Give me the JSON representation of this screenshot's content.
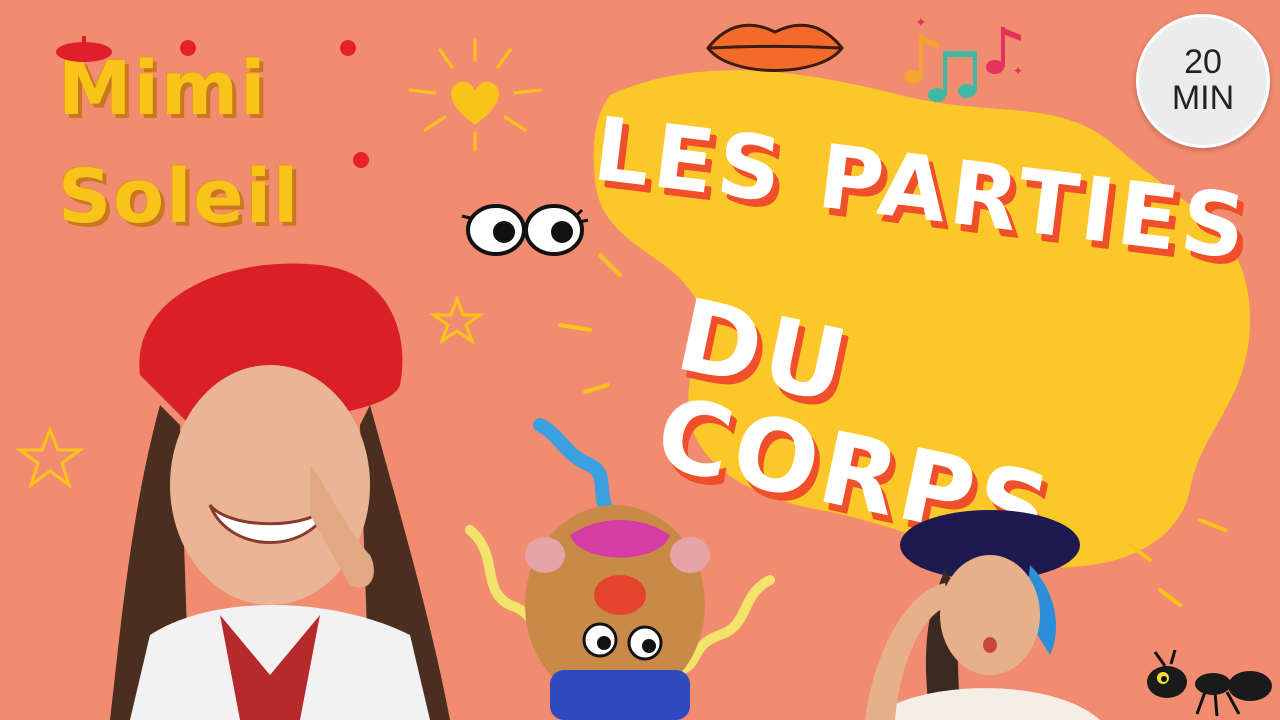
{
  "logo": {
    "line1": "Mimi",
    "line2": "Soleil"
  },
  "title": {
    "line1": "Les parties",
    "line2": "du corps"
  },
  "badge": {
    "number": "20",
    "unit": "MIN"
  },
  "icons": [
    "lips-icon",
    "music-notes-icon",
    "heart-sun-icon",
    "eyes-icon",
    "star-icon",
    "ant-icon"
  ],
  "colors": {
    "background": "#f28c70",
    "blob": "#fbc829",
    "logo": "#f9c31a",
    "title_shadow": "#ef4f2a"
  }
}
